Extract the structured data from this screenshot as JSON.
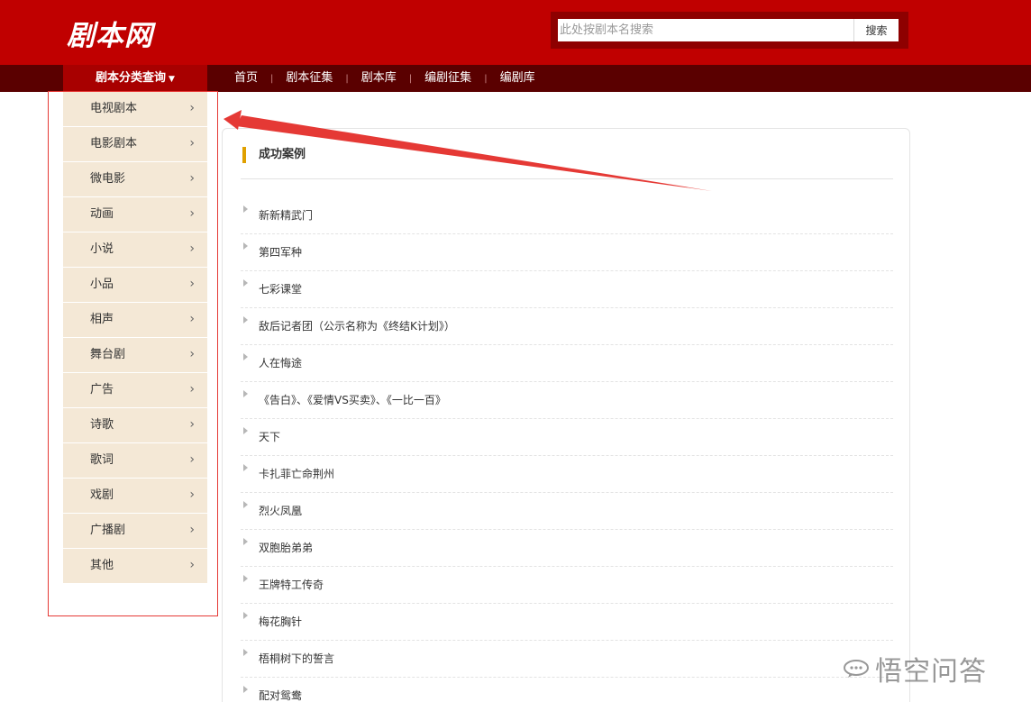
{
  "header": {
    "logo": "剧本网",
    "search": {
      "placeholder": "此处按剧本名搜索",
      "value": "",
      "button_label": "搜索"
    }
  },
  "nav": {
    "category_label": "剧本分类查询",
    "links": [
      "首页",
      "剧本征集",
      "剧本库",
      "编剧征集",
      "编剧库"
    ]
  },
  "sidebar": {
    "items": [
      {
        "label": "电视剧本"
      },
      {
        "label": "电影剧本"
      },
      {
        "label": "微电影"
      },
      {
        "label": "动画"
      },
      {
        "label": "小说"
      },
      {
        "label": "小品"
      },
      {
        "label": "相声"
      },
      {
        "label": "舞台剧"
      },
      {
        "label": "广告"
      },
      {
        "label": "诗歌"
      },
      {
        "label": "歌词"
      },
      {
        "label": "戏剧"
      },
      {
        "label": "广播剧"
      },
      {
        "label": "其他"
      }
    ],
    "arrow_glyph": "›"
  },
  "main": {
    "section_title": "成功案例",
    "cases": [
      "新新精武门",
      "第四军种",
      "七彩课堂",
      "敌后记者团（公示名称为《终结K计划》）",
      "人在悔途",
      "《告白》、《爱情VS买卖》、《一比一百》",
      "天下",
      "卡扎菲亡命荆州",
      "烈火凤凰",
      "双胞胎弟弟",
      "王牌特工传奇",
      "梅花胸针",
      "梧桐树下的誓言",
      "配对鸳鸯"
    ]
  },
  "watermark": {
    "text": "悟空问答"
  },
  "colors": {
    "header_red": "#c00000",
    "nav_dark": "#5a0000",
    "sidebar_bg": "#f4e8d6",
    "annotation_red": "#e53935",
    "title_accent": "#e0a000"
  }
}
